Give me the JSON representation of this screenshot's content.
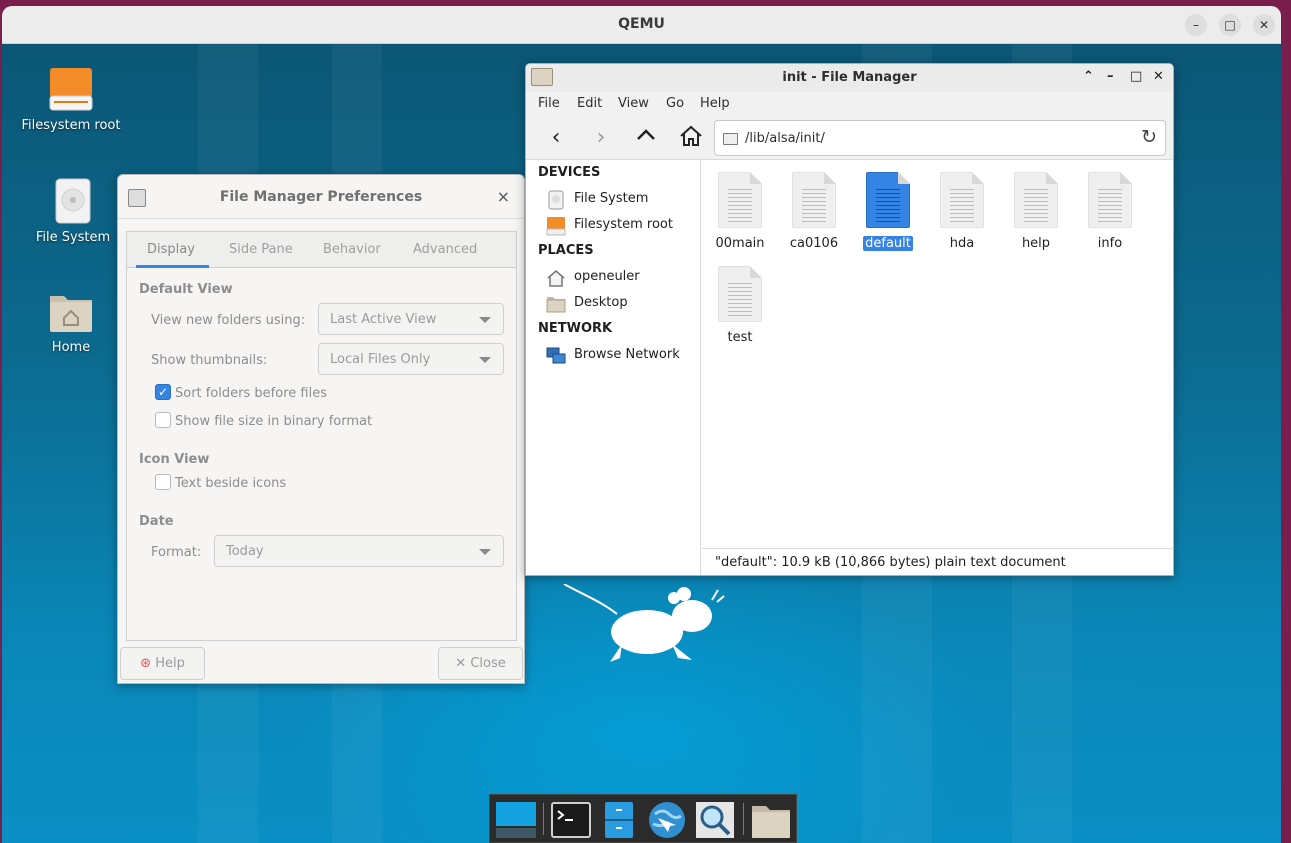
{
  "qemu": {
    "title": "QEMU",
    "minimize_glyph": "–",
    "maximize_glyph": "□",
    "close_glyph": "✕"
  },
  "desktop": {
    "icons": [
      {
        "label": "Filesystem root",
        "icon": "drive-orange-icon"
      },
      {
        "label": "File System",
        "icon": "drive-harddisk-icon"
      },
      {
        "label": "Home",
        "icon": "home-folder-icon"
      }
    ]
  },
  "prefs": {
    "title": "File Manager Preferences",
    "close_glyph": "×",
    "tabs": [
      "Display",
      "Side Pane",
      "Behavior",
      "Advanced"
    ],
    "active_tab": "Display",
    "default_view": {
      "heading": "Default View",
      "view_new_label": "View new folders using:",
      "view_new_value": "Last Active View",
      "thumbnails_label": "Show thumbnails:",
      "thumbnails_value": "Local Files Only",
      "sort_folders_label": "Sort folders before files",
      "sort_folders_checked": true,
      "binary_size_label": "Show file size in binary format",
      "binary_size_checked": false
    },
    "icon_view": {
      "heading": "Icon View",
      "text_beside_label": "Text beside icons",
      "text_beside_checked": false
    },
    "date": {
      "heading": "Date",
      "format_label": "Format:",
      "format_value": "Today"
    },
    "help_label": "Help",
    "close_label": "Close"
  },
  "file_manager": {
    "title": "init - File Manager",
    "menu": [
      "File",
      "Edit",
      "View",
      "Go",
      "Help"
    ],
    "location": "/lib/alsa/init/",
    "sidebar": {
      "devices_heading": "DEVICES",
      "devices": [
        "File System",
        "Filesystem root"
      ],
      "places_heading": "PLACES",
      "places": [
        "openeuler",
        "Desktop"
      ],
      "network_heading": "NETWORK",
      "network": [
        "Browse Network"
      ]
    },
    "files": [
      "00main",
      "ca0106",
      "default",
      "hda",
      "help",
      "info",
      "test"
    ],
    "selected_file": "default",
    "status": "\"default\": 10.9 kB (10,866 bytes) plain text document"
  },
  "dock": {
    "items": [
      "show-desktop-icon",
      "terminal-icon",
      "file-cabinet-icon",
      "web-browser-icon",
      "search-icon",
      "folder-icon"
    ]
  },
  "colors": {
    "accent": "#3584e4",
    "desktop": "#0a87b8",
    "drive_orange": "#f28c28"
  }
}
